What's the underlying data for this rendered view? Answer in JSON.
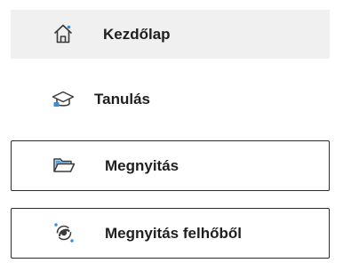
{
  "nav": {
    "items": [
      {
        "label": "Kezdőlap",
        "icon": "home-icon"
      },
      {
        "label": "Tanulás",
        "icon": "graduation-cap-icon"
      },
      {
        "label": "Megnyitás",
        "icon": "folder-open-icon"
      },
      {
        "label": "Megnyitás felhőből",
        "icon": "cloud-sync-icon"
      }
    ]
  },
  "colors": {
    "selected_bg": "#f0f0f0",
    "icon_stroke": "#3a3a3a",
    "accent": "#2f8fe0",
    "border": "#2b2b2b"
  }
}
